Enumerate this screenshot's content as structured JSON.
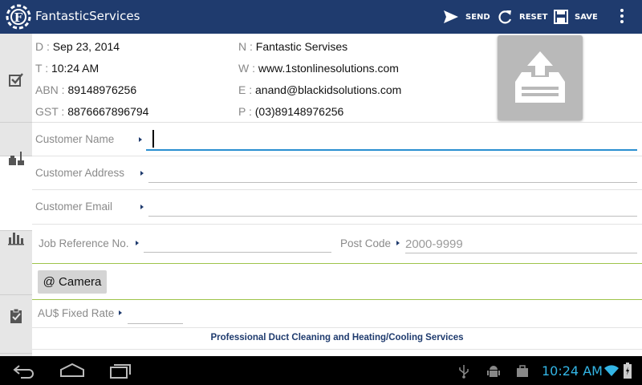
{
  "app": {
    "title": "FantasticServices",
    "actions": {
      "send": "SEND",
      "reset": "RESET",
      "save": "SAVE"
    }
  },
  "info": {
    "date_label": "D :",
    "date_value": "Sep 23, 2014",
    "time_label": "T :",
    "time_value": "10:24 AM",
    "abn_label": "ABN :",
    "abn_value": "89148976256",
    "gst_label": "GST :",
    "gst_value": "8876667896794",
    "name_label": "N :",
    "name_value": "Fantastic Servises",
    "web_label": "W :",
    "web_value": "www.1stonlinesolutions.com",
    "email_label": "E :",
    "email_value": "anand@blackidsolutions.com",
    "phone_label": "P :",
    "phone_value": "(03)89148976256"
  },
  "form": {
    "customer_name_label": "Customer Name",
    "customer_name_value": "",
    "customer_address_label": "Customer Address",
    "customer_address_value": "",
    "customer_email_label": "Customer Email",
    "customer_email_value": "",
    "job_ref_label": "Job Reference No.",
    "job_ref_value": "",
    "post_code_label": "Post Code",
    "post_code_placeholder": "2000-9999",
    "camera_label": "@ Camera",
    "fixed_rate_label": "AU$ Fixed Rate",
    "fixed_rate_value": ""
  },
  "footer": {
    "tagline": "Professional Duct Cleaning and Heating/Cooling Services"
  },
  "system": {
    "clock": "10:24 AM"
  },
  "icons": {
    "logo": "app-logo-icon",
    "send": "send-icon",
    "reset": "refresh-icon",
    "save": "save-icon",
    "overflow": "overflow-menu-icon",
    "upload": "upload-icon"
  },
  "colors": {
    "action_bar": "#1f3b6e",
    "accent_blue": "#2a8fd0",
    "green_rule": "#9ec44a",
    "clock": "#33b5e5"
  }
}
